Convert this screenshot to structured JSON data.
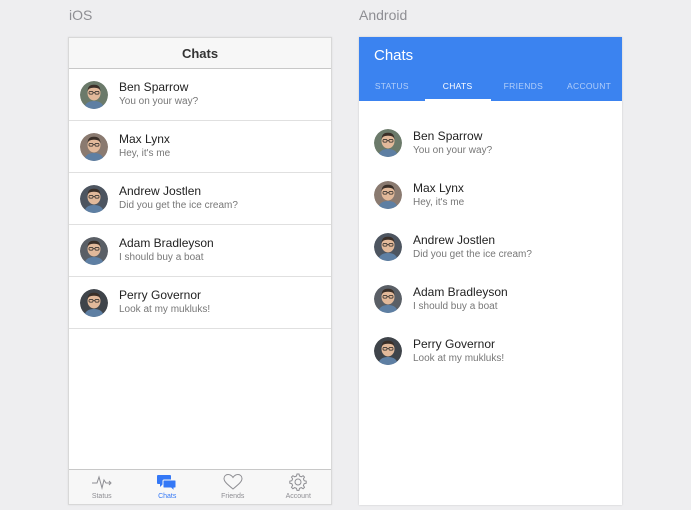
{
  "labels": {
    "ios": "iOS",
    "android": "Android"
  },
  "ios": {
    "nav_title": "Chats",
    "chats": [
      {
        "name": "Ben Sparrow",
        "message": "You on your way?"
      },
      {
        "name": "Max Lynx",
        "message": "Hey, it's me"
      },
      {
        "name": "Andrew Jostlen",
        "message": "Did you get the ice cream?"
      },
      {
        "name": "Adam Bradleyson",
        "message": "I should buy a boat"
      },
      {
        "name": "Perry Governor",
        "message": "Look at my mukluks!"
      }
    ],
    "tabs": [
      {
        "label": "Status",
        "icon": "pulse-icon"
      },
      {
        "label": "Chats",
        "icon": "chat-bubbles-icon"
      },
      {
        "label": "Friends",
        "icon": "heart-icon"
      },
      {
        "label": "Account",
        "icon": "gear-icon"
      }
    ],
    "active_tab": "Chats"
  },
  "android": {
    "title": "Chats",
    "tabs": [
      "STATUS",
      "CHATS",
      "FRIENDS",
      "ACCOUNT"
    ],
    "active_tab": "CHATS",
    "chats": [
      {
        "name": "Ben Sparrow",
        "message": "You on your way?"
      },
      {
        "name": "Max Lynx",
        "message": "Hey, it's me"
      },
      {
        "name": "Andrew Jostlen",
        "message": "Did you get the ice cream?"
      },
      {
        "name": "Adam Bradleyson",
        "message": "I should buy a boat"
      },
      {
        "name": "Perry Governor",
        "message": "Look at my mukluks!"
      }
    ]
  },
  "colors": {
    "accent_ios": "#3478f6",
    "android_bar": "#3b83f0",
    "avatars": [
      "#6b7a6a",
      "#8a7a70",
      "#4d5560",
      "#5a5f66",
      "#3f444a"
    ]
  }
}
